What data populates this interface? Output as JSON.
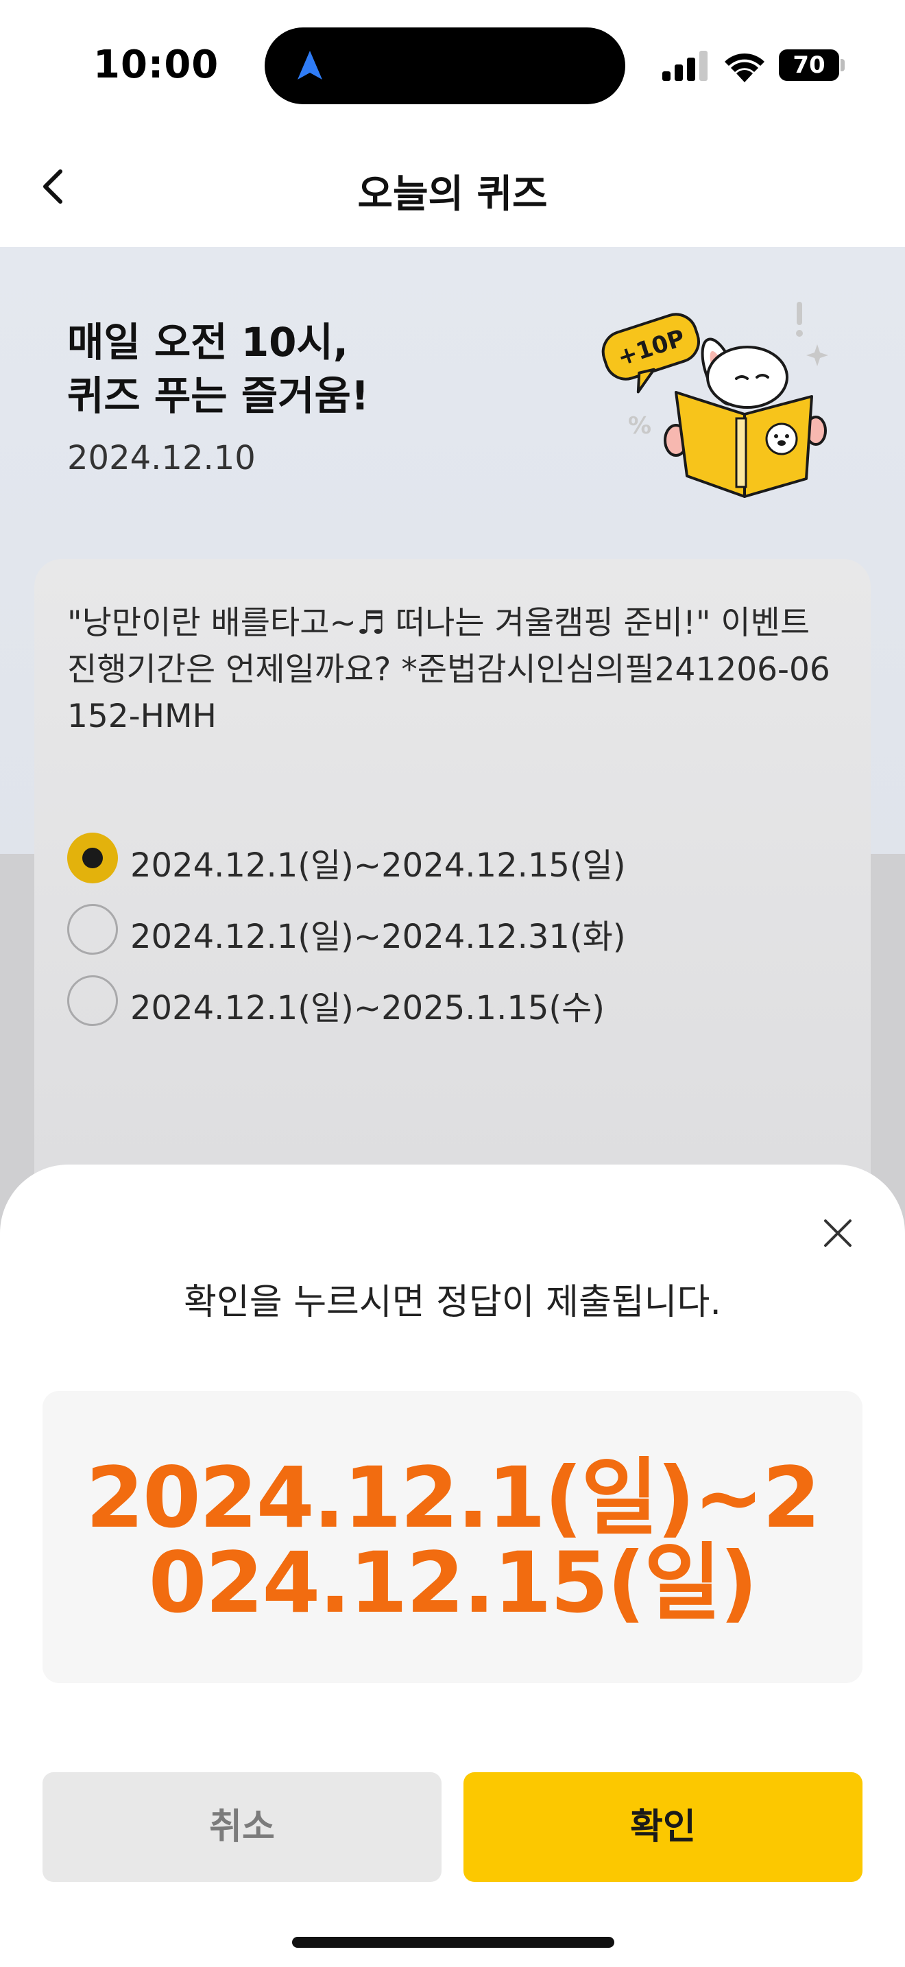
{
  "status_bar": {
    "time": "10:00",
    "battery_level": "70",
    "icons": [
      "navigation-arrow-icon",
      "signal-icon",
      "wifi-icon",
      "battery-icon"
    ],
    "nav_arrow_color": "#2f7cf6"
  },
  "nav": {
    "title": "오늘의 퀴즈",
    "back_icon": "chevron-left-icon"
  },
  "hero": {
    "title_line1": "매일 오전 10시,",
    "title_line2": "퀴즈 푸는 즐거움!",
    "date": "2024.12.10",
    "badge": "+10P"
  },
  "quiz": {
    "question": "\"낭만이란 배를타고~♬ 떠나는 겨울캠핑 준비!\" 이벤트 진행기간은 언제일까요? *준법감시인심의필241206-06152-HMH",
    "options": [
      {
        "label": "2024.12.1(일)~2024.12.15(일)",
        "selected": true
      },
      {
        "label": "2024.12.1(일)~2024.12.31(화)",
        "selected": false
      },
      {
        "label": "2024.12.1(일)~2025.1.15(수)",
        "selected": false
      }
    ],
    "selected_color": "#e3b20c"
  },
  "sheet": {
    "message": "확인을 누르시면 정답이 제출됩니다.",
    "answer": "2024.12.1(일)~2024.12.15(일)",
    "answer_color": "#f26c10",
    "cancel_label": "취소",
    "confirm_label": "확인",
    "confirm_color": "#fcc800",
    "close_icon": "close-icon"
  }
}
